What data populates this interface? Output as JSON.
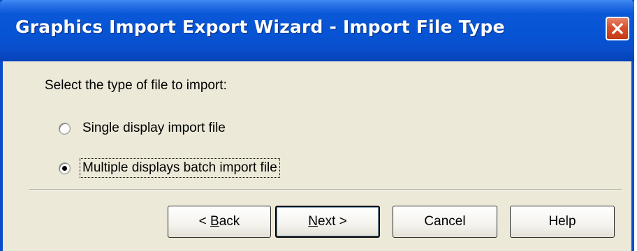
{
  "window": {
    "title": "Graphics Import Export Wizard - Import File Type"
  },
  "prompt": "Select the type of file to import:",
  "options": [
    {
      "label": "Single display import file",
      "selected": false
    },
    {
      "label": "Multiple displays batch import file",
      "selected": true
    }
  ],
  "buttons": {
    "back": {
      "mnemonic": "B",
      "rest": "ack",
      "prefix": "< "
    },
    "next": {
      "mnemonic": "N",
      "rest": "ext >"
    },
    "cancel": "Cancel",
    "help": "Help"
  },
  "colors": {
    "titlebar": "#0654d4",
    "frame": "#0a4ccc",
    "dialog_bg": "#ece9d8",
    "close_button": "#d8502c"
  },
  "icons": {
    "close": "close-x-icon"
  }
}
